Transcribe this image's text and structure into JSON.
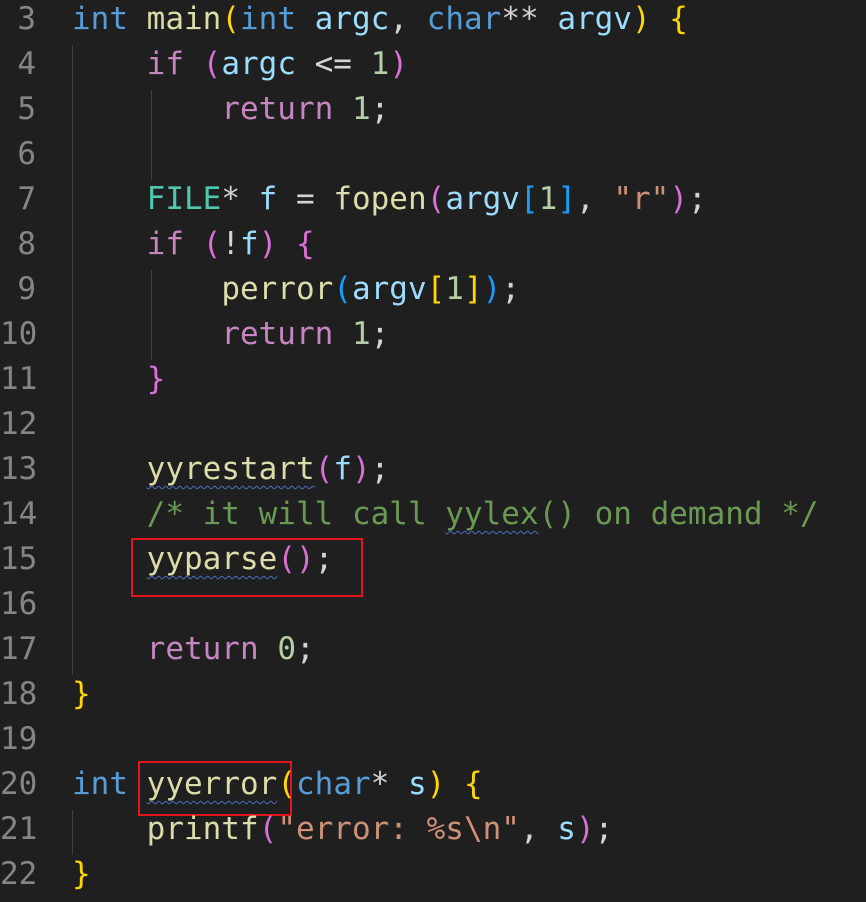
{
  "editor": {
    "lines": [
      {
        "n": "3",
        "tokens": [
          [
            "int",
            "kw"
          ],
          [
            " ",
            "op"
          ],
          [
            "main",
            "fn"
          ],
          [
            "(",
            "b1"
          ],
          [
            "int",
            "kw"
          ],
          [
            " ",
            "op"
          ],
          [
            "argc",
            "var"
          ],
          [
            ", ",
            "op"
          ],
          [
            "char",
            "kw"
          ],
          [
            "** ",
            "op"
          ],
          [
            "argv",
            "var"
          ],
          [
            ") ",
            "b1"
          ],
          [
            "{",
            "b1"
          ]
        ]
      },
      {
        "n": "4",
        "tokens": [
          [
            "    ",
            "op"
          ],
          [
            "if",
            "ctl"
          ],
          [
            " ",
            "op"
          ],
          [
            "(",
            "b2"
          ],
          [
            "argc",
            "var"
          ],
          [
            " <= ",
            "op"
          ],
          [
            "1",
            "num"
          ],
          [
            ")",
            "b2"
          ]
        ]
      },
      {
        "n": "5",
        "tokens": [
          [
            "        ",
            "op"
          ],
          [
            "return",
            "ctl"
          ],
          [
            " ",
            "op"
          ],
          [
            "1",
            "num"
          ],
          [
            ";",
            "op"
          ]
        ]
      },
      {
        "n": "6",
        "tokens": []
      },
      {
        "n": "7",
        "tokens": [
          [
            "    ",
            "op"
          ],
          [
            "FILE",
            "type"
          ],
          [
            "* ",
            "op"
          ],
          [
            "f",
            "var"
          ],
          [
            " = ",
            "op"
          ],
          [
            "fopen",
            "fn"
          ],
          [
            "(",
            "b2"
          ],
          [
            "argv",
            "var"
          ],
          [
            "[",
            "b3"
          ],
          [
            "1",
            "num"
          ],
          [
            "]",
            "b3"
          ],
          [
            ", ",
            "op"
          ],
          [
            "\"r\"",
            "str"
          ],
          [
            ")",
            "b2"
          ],
          [
            ";",
            "op"
          ]
        ]
      },
      {
        "n": "8",
        "tokens": [
          [
            "    ",
            "op"
          ],
          [
            "if",
            "ctl"
          ],
          [
            " ",
            "op"
          ],
          [
            "(",
            "b2"
          ],
          [
            "!",
            "op"
          ],
          [
            "f",
            "var"
          ],
          [
            ")",
            "b2"
          ],
          [
            " ",
            "op"
          ],
          [
            "{",
            "b2"
          ]
        ]
      },
      {
        "n": "9",
        "tokens": [
          [
            "        ",
            "op"
          ],
          [
            "perror",
            "fn"
          ],
          [
            "(",
            "b3"
          ],
          [
            "argv",
            "var"
          ],
          [
            "[",
            "b1"
          ],
          [
            "1",
            "num"
          ],
          [
            "]",
            "b1"
          ],
          [
            ")",
            "b3"
          ],
          [
            ";",
            "op"
          ]
        ]
      },
      {
        "n": "10",
        "tokens": [
          [
            "        ",
            "op"
          ],
          [
            "return",
            "ctl"
          ],
          [
            " ",
            "op"
          ],
          [
            "1",
            "num"
          ],
          [
            ";",
            "op"
          ]
        ]
      },
      {
        "n": "11",
        "tokens": [
          [
            "    ",
            "op"
          ],
          [
            "}",
            "b2"
          ]
        ]
      },
      {
        "n": "12",
        "tokens": []
      },
      {
        "n": "13",
        "tokens": [
          [
            "    ",
            "op"
          ],
          [
            "yyrestart",
            "fn",
            "squig"
          ],
          [
            "(",
            "b2"
          ],
          [
            "f",
            "var"
          ],
          [
            ")",
            "b2"
          ],
          [
            ";",
            "op"
          ]
        ]
      },
      {
        "n": "14",
        "tokens": [
          [
            "    ",
            "op"
          ],
          [
            "/* it will call ",
            "cmt"
          ],
          [
            "yylex",
            "cmt",
            "squig"
          ],
          [
            "() on demand */",
            "cmt"
          ]
        ]
      },
      {
        "n": "15",
        "tokens": [
          [
            "    ",
            "op"
          ],
          [
            "yyparse",
            "fn",
            "squig"
          ],
          [
            "(",
            "b2"
          ],
          [
            ")",
            "b2"
          ],
          [
            ";",
            "op"
          ]
        ]
      },
      {
        "n": "16",
        "tokens": []
      },
      {
        "n": "17",
        "tokens": [
          [
            "    ",
            "op"
          ],
          [
            "return",
            "ctl"
          ],
          [
            " ",
            "op"
          ],
          [
            "0",
            "num"
          ],
          [
            ";",
            "op"
          ]
        ]
      },
      {
        "n": "18",
        "tokens": [
          [
            "}",
            "b1"
          ]
        ]
      },
      {
        "n": "19",
        "tokens": []
      },
      {
        "n": "20",
        "tokens": [
          [
            "int",
            "kw"
          ],
          [
            " ",
            "op"
          ],
          [
            "yyerror",
            "fn",
            "squig"
          ],
          [
            "(",
            "b1"
          ],
          [
            "char",
            "kw"
          ],
          [
            "* ",
            "op"
          ],
          [
            "s",
            "var"
          ],
          [
            ")",
            "b1"
          ],
          [
            " ",
            "op"
          ],
          [
            "{",
            "b1"
          ]
        ]
      },
      {
        "n": "21",
        "tokens": [
          [
            "    ",
            "op"
          ],
          [
            "printf",
            "fn"
          ],
          [
            "(",
            "b2"
          ],
          [
            "\"error: %s\\n\"",
            "str"
          ],
          [
            ", ",
            "op"
          ],
          [
            "s",
            "var"
          ],
          [
            ")",
            "b2"
          ],
          [
            ";",
            "op"
          ]
        ]
      },
      {
        "n": "22",
        "tokens": [
          [
            "}",
            "b1"
          ]
        ]
      }
    ]
  }
}
